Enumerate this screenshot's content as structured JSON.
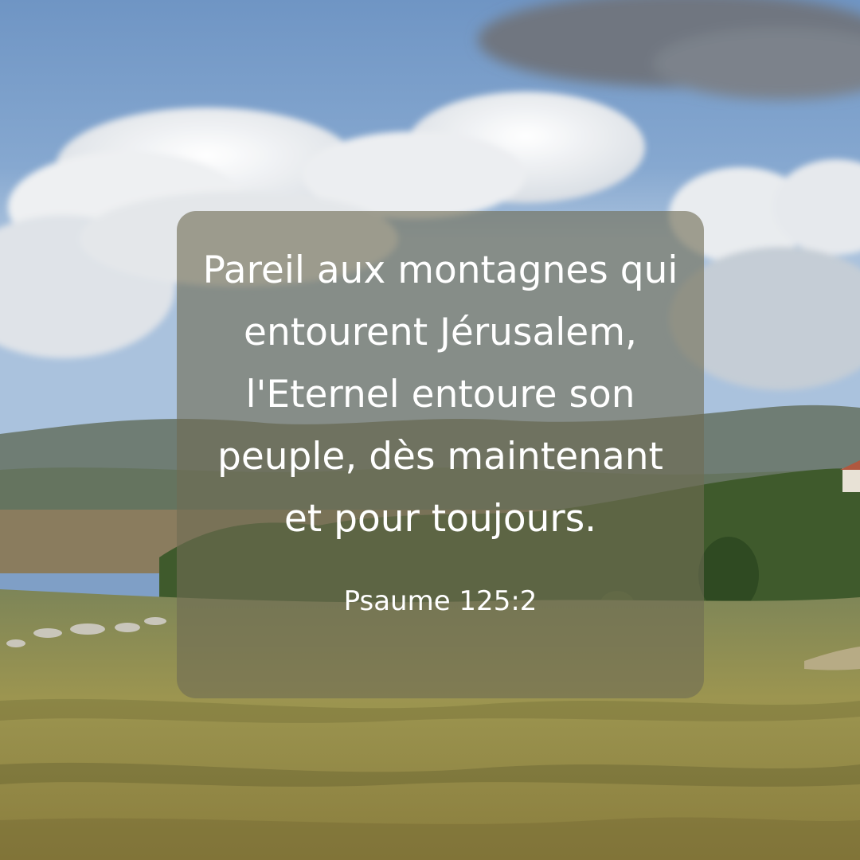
{
  "verse": {
    "text": "Pareil aux montagnes qui entourent Jérusalem, l'Eternel entoure son peuple, dès maintenant et pour toujours.",
    "reference": "Psaume 125:2"
  },
  "colors": {
    "sky_top": "#6f95c4",
    "sky_low": "#aac2dd",
    "cloud": "#f4f5f6",
    "hills_far": "#6f7d74",
    "trees": "#3f5a2c",
    "field": "#9c9550",
    "card_overlay": "#706c54",
    "text": "#ffffff"
  }
}
